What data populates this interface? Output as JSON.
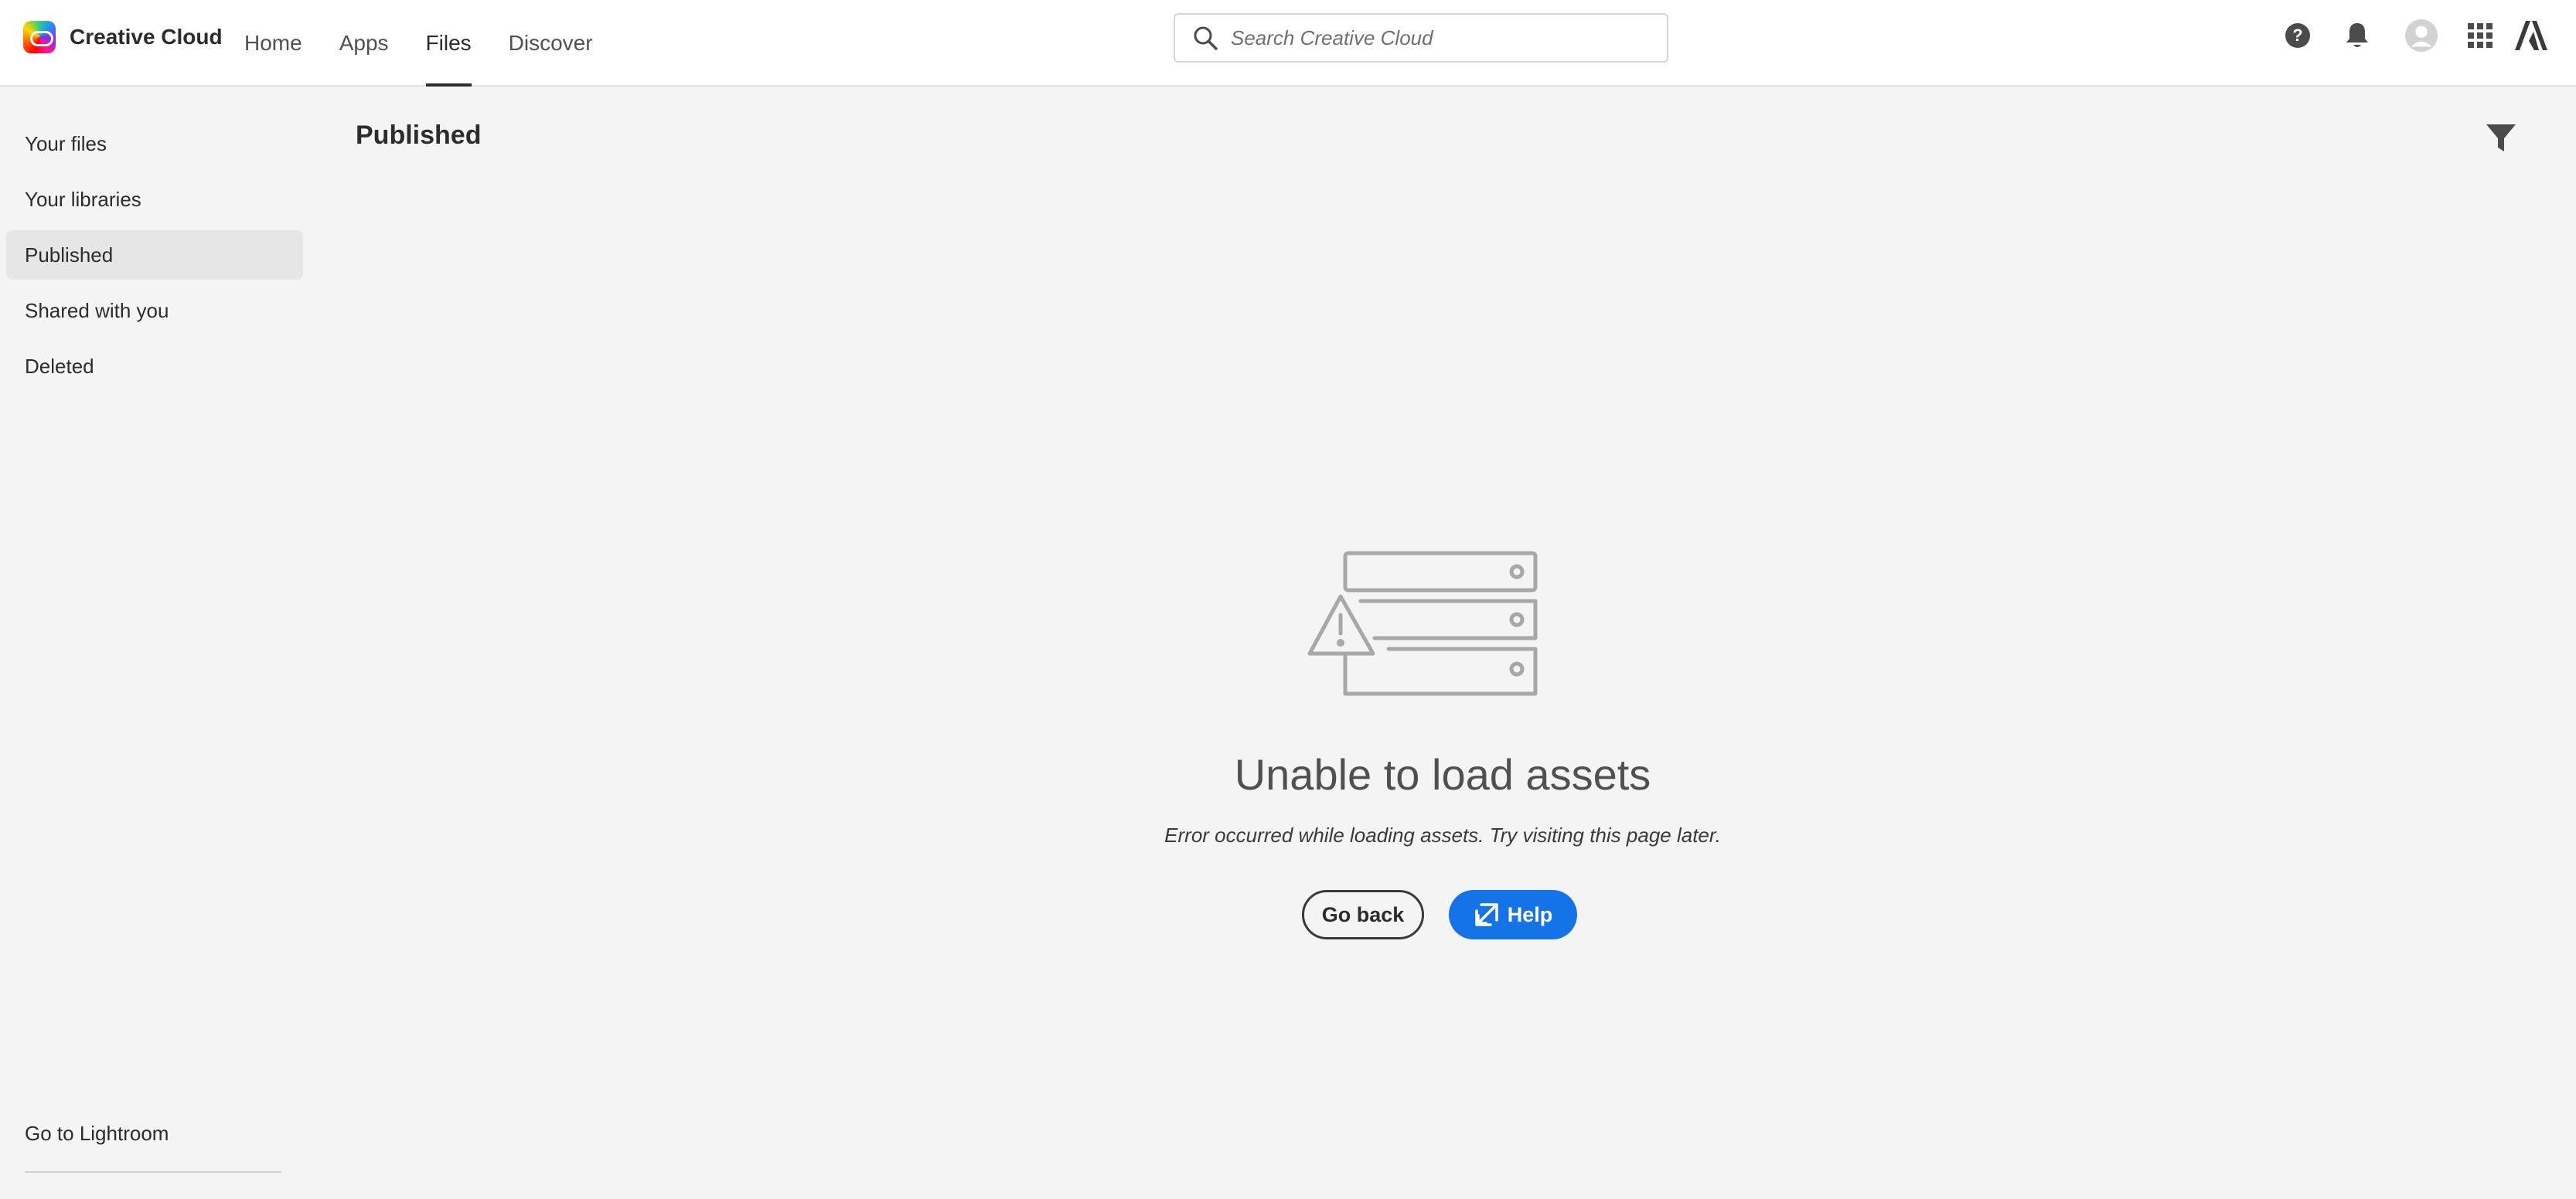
{
  "header": {
    "brand": "Creative Cloud",
    "nav": [
      {
        "label": "Home",
        "active": false
      },
      {
        "label": "Apps",
        "active": false
      },
      {
        "label": "Files",
        "active": true
      },
      {
        "label": "Discover",
        "active": false
      }
    ],
    "search": {
      "placeholder": "Search Creative Cloud",
      "value": ""
    },
    "icons": [
      "help-icon",
      "bell-icon",
      "avatar",
      "apps-grid-icon",
      "adobe-logo-icon"
    ]
  },
  "sidebar": {
    "items": [
      {
        "label": "Your files",
        "active": false
      },
      {
        "label": "Your libraries",
        "active": false
      },
      {
        "label": "Published",
        "active": true
      },
      {
        "label": "Shared with you",
        "active": false
      },
      {
        "label": "Deleted",
        "active": false
      }
    ],
    "footer_link": "Go to Lightroom"
  },
  "main": {
    "title": "Published",
    "filter_icon": "filter-icon",
    "error": {
      "illustration": "server-warning-icon",
      "title": "Unable to load assets",
      "description": "Error occurred while loading assets. Try visiting this page later.",
      "back_label": "Go back",
      "help_label": "Help",
      "help_icon": "external-link-icon"
    }
  },
  "colors": {
    "accent": "#1473e6",
    "background": "#f4f4f4",
    "header_bg": "#ffffff",
    "active_item_bg": "#e6e6e6"
  }
}
